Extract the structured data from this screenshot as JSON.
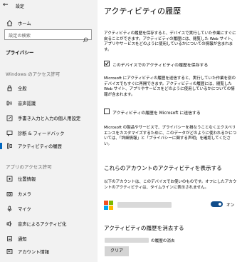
{
  "window": {
    "back_glyph": "←",
    "title": "設定"
  },
  "sidebar": {
    "home_label": "ホーム",
    "search_placeholder": "設定の検索",
    "category": "プライバシー",
    "sections": [
      {
        "label": "Windows のアクセス許可"
      },
      {
        "label": "アプリのアクセス許可"
      }
    ],
    "windows_items": [
      {
        "label": "全般",
        "icon": "lock-icon"
      },
      {
        "label": "音声認識",
        "icon": "speech-icon"
      },
      {
        "label": "手書き入力と入力の個人用設定",
        "icon": "pen-icon"
      },
      {
        "label": "診断 & フィードバック",
        "icon": "feedback-icon"
      },
      {
        "label": "アクティビティの履歴",
        "icon": "history-icon",
        "active": true
      }
    ],
    "app_items": [
      {
        "label": "位置情報",
        "icon": "location-icon"
      },
      {
        "label": "カメラ",
        "icon": "camera-icon"
      },
      {
        "label": "マイク",
        "icon": "microphone-icon"
      },
      {
        "label": "音声によるアクティビ化",
        "icon": "voice-activation-icon"
      },
      {
        "label": "通知",
        "icon": "notification-icon"
      },
      {
        "label": "アカウント情報",
        "icon": "account-icon"
      }
    ]
  },
  "main": {
    "title": "アクティビティの履歴",
    "intro": "アクティビティの履歴を保存すると、デバイスで実行していた作業にすぐに戻ることができます。アクティビティの履歴には、閲覧した Web サイト、アプリやサービスをどのように使用しているかについての情報が含まれます。",
    "store_checkbox": {
      "label": "このデバイスでのアクティビティの履歴を保存する",
      "checked": true
    },
    "send_desc": "Microsoft にアクティビティの履歴を送信すると、実行していた作業を別のデバイスでもすぐに再開できます。アクティビティの履歴には、閲覧した Web サイト、アプリやサービスをどのように使用しているかについての情報が含まれます。",
    "send_checkbox": {
      "label": "アクティビティの履歴を Microsoft に送信する",
      "checked": false
    },
    "products_desc": "Microsoft の製品やサービスで、プライバシーを損なうことなくエクスペリエンスをカスタマイズするために、このデータがどのように使われるかについては、「詳細情報」と「プライバシーに関する声明」を確認してください。",
    "accounts_heading": "これらのアカウントのアクティビティを表示する",
    "accounts_desc": "以下のアカウントは、このデバイスでお使いのものです。オフにしたアカウントのアクティビティは、タイムラインに表示されません。",
    "toggle": {
      "state": "オン",
      "on": true
    },
    "clear_heading": "アクティビティの履歴を消去する",
    "clear_account_suffix": "の履歴の消去",
    "clear_button": "クリア",
    "colors": {
      "accent": "#0067c0",
      "toggle_on": "#0f4c8a"
    }
  }
}
